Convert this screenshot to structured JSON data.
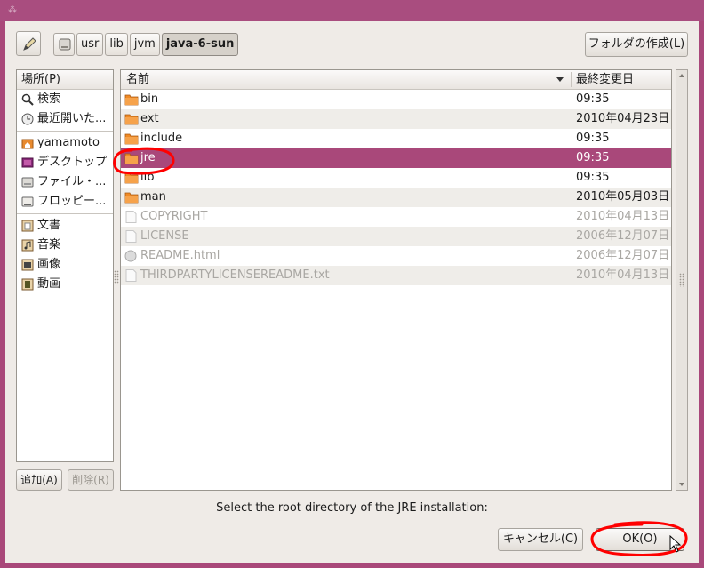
{
  "window": {
    "title_icon": "window-menu-icon"
  },
  "toolbar": {
    "edit_icon": "pencil-icon",
    "breadcrumbs": [
      "usr",
      "lib",
      "jvm",
      "java-6-sun"
    ],
    "disk_icon": "harddisk-icon",
    "new_folder_label": "フォルダの作成(L)"
  },
  "places": {
    "header": "場所(P)",
    "items": [
      {
        "label": "検索",
        "icon": "search-icon"
      },
      {
        "label": "最近開いた...",
        "icon": "recent-icon"
      },
      {
        "label": "yamamoto",
        "icon": "home-folder-icon"
      },
      {
        "label": "デスクトップ",
        "icon": "desktop-icon"
      },
      {
        "label": "ファイル・...",
        "icon": "filesystem-icon"
      },
      {
        "label": "フロッピー...",
        "icon": "floppy-icon"
      },
      {
        "label": "文書",
        "icon": "documents-icon"
      },
      {
        "label": "音楽",
        "icon": "music-icon"
      },
      {
        "label": "画像",
        "icon": "pictures-icon"
      },
      {
        "label": "動画",
        "icon": "videos-icon"
      }
    ],
    "add_label": "追加(A)",
    "remove_label": "削除(R)"
  },
  "files": {
    "columns": {
      "name": "名前",
      "modified": "最終変更日"
    },
    "rows": [
      {
        "name": "bin",
        "modified": "09:35",
        "type": "folder"
      },
      {
        "name": "ext",
        "modified": "2010年04月23日",
        "type": "folder"
      },
      {
        "name": "include",
        "modified": "09:35",
        "type": "folder"
      },
      {
        "name": "jre",
        "modified": "09:35",
        "type": "folder",
        "selected": true
      },
      {
        "name": "lib",
        "modified": "09:35",
        "type": "folder"
      },
      {
        "name": "man",
        "modified": "2010年05月03日",
        "type": "folder"
      },
      {
        "name": "COPYRIGHT",
        "modified": "2010年04月13日",
        "type": "file"
      },
      {
        "name": "LICENSE",
        "modified": "2006年12月07日",
        "type": "file"
      },
      {
        "name": "README.html",
        "modified": "2006年12月07日",
        "type": "html"
      },
      {
        "name": "THIRDPARTYLICENSEREADME.txt",
        "modified": "2010年04月13日",
        "type": "file"
      }
    ]
  },
  "prompt": "Select the root directory of the JRE installation:",
  "buttons": {
    "cancel": "キャンセル(C)",
    "ok": "OK(O)"
  },
  "colors": {
    "accent": "#a9487a",
    "annotation": "#ff0000",
    "folder": "#f08a24"
  }
}
